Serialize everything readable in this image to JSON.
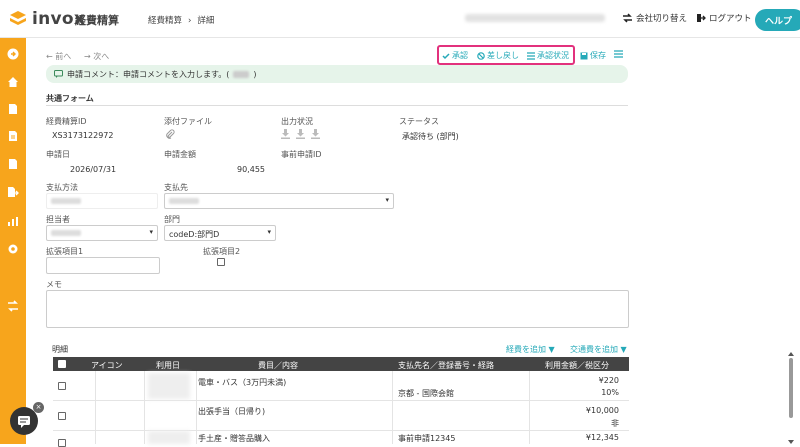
{
  "header": {
    "logo_text": "invox",
    "logo_sub": "経費精算",
    "breadcrumb": [
      "経費精算",
      "詳細"
    ],
    "switch_company": "会社切り替え",
    "logout": "ログアウト",
    "help": "ヘルプ"
  },
  "toolbar": {
    "prev": "← 前へ",
    "next": "→ 次へ",
    "approve": "承認",
    "send_back": "差し戻し",
    "approval_status": "承認状況",
    "save": "保存"
  },
  "comment": {
    "text": "申請コメント：申請コメントを入力します。(",
    "suffix": ")"
  },
  "form": {
    "section_title": "共通フォーム",
    "expense_id_label": "経費精算ID",
    "expense_id_value": "XS3173122972",
    "attachment_label": "添付ファイル",
    "output_label": "出力状況",
    "status_label": "ステータス",
    "status_value": "承認待ち (部門)",
    "apply_date_label": "申請日",
    "apply_date_value": "2026/07/31",
    "amount_label": "申請金額",
    "amount_value": "90,455",
    "pre_apply_label": "事前申請ID",
    "payment_method_label": "支払方法",
    "payee_label": "支払先",
    "owner_label": "担当者",
    "department_label": "部門",
    "department_value": "codeD:部門D",
    "ext1_label": "拡張項目1",
    "ext2_label": "拡張項目2",
    "memo_label": "メモ"
  },
  "details": {
    "title": "明細",
    "add_expense": "経費を追加 ▼",
    "add_transport": "交通費を追加 ▼",
    "columns": [
      "アイコン",
      "利用日",
      "費目／内容",
      "支払先名／登録番号・経路",
      "利用金額／税区分"
    ],
    "rows": [
      {
        "item": "電車・バス（3万円未満)",
        "route": "京都 - 国際会館",
        "amount": "¥220",
        "tax": "10%"
      },
      {
        "item": "出張手当（日帰り)",
        "route": "",
        "amount": "¥10,000",
        "tax": "非"
      },
      {
        "item": "手土産・贈答品購入",
        "route": "事前申請12345",
        "amount": "¥12,345",
        "tax": ""
      }
    ]
  },
  "colors": {
    "accent": "#25a9b8",
    "rail": "#f7a51c",
    "highlight": "#e2317d"
  }
}
